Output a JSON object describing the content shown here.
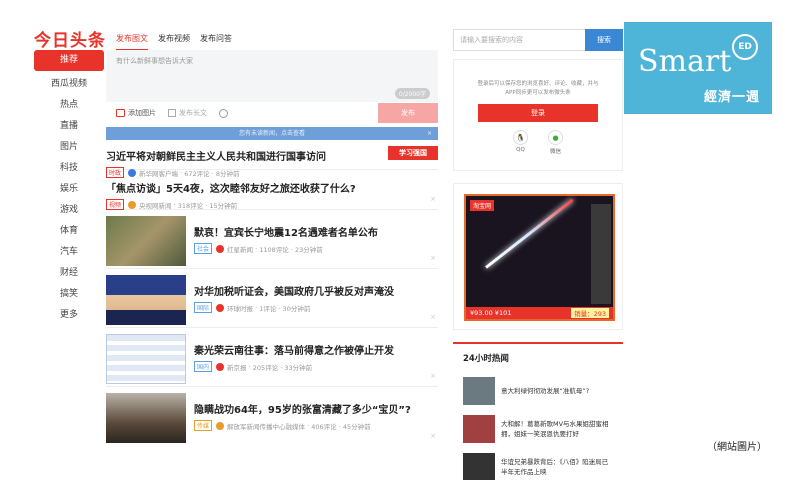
{
  "app": {
    "logo": "今日头条"
  },
  "nav": [
    "推荐",
    "西瓜视频",
    "热点",
    "直播",
    "图片",
    "科技",
    "娱乐",
    "游戏",
    "体育",
    "汽车",
    "财经",
    "搞笑",
    "更多"
  ],
  "composer": {
    "tabs": [
      "发布图文",
      "发布视频",
      "发布问答"
    ],
    "placeholder": "有什么新鲜事想告诉大家",
    "counter": "0/2000字",
    "add_image": "添加图片",
    "long_text": "发布长文",
    "publish": "发布"
  },
  "notice": "您有未读新闻，点击查看",
  "feed": [
    {
      "title": "习近平将对朝鲜民主主义人民共和国进行国事访问",
      "source": "新华网客户端",
      "meta": "672评论 · 8分钟前",
      "tag": "时政",
      "badge": "学习强国"
    },
    {
      "title": "「焦点访谈」5天4夜，这次睦邻友好之旅还收获了什么?",
      "source": "央视网新闻",
      "meta": "318评论 · 15分钟前",
      "tag": "视频"
    },
    {
      "title": "默哀！宜宾长宁地震12名遇难者名单公布",
      "source": "红星新闻",
      "meta": "1108评论 · 23分钟前",
      "tag": "社会"
    },
    {
      "title": "对华加税听证会，美国政府几乎被反对声淹没",
      "source": "环球时报",
      "meta": "1评论 · 30分钟前",
      "tag": "国际"
    },
    {
      "title": "秦光荣云南往事：落马前得意之作被停止开发",
      "source": "新京报",
      "meta": "205评论 · 33分钟前",
      "tag": "国内"
    },
    {
      "title": "隐瞒战功64年，95岁的张富清藏了多少“宝贝”?",
      "source": "解放军新闻传播中心融媒体",
      "meta": "406评论 · 45分钟前",
      "tag": "传媒"
    }
  ],
  "search": {
    "placeholder": "请输入要搜索的内容",
    "button": "搜索"
  },
  "brand": {
    "name": "Smart",
    "badge": "ED",
    "sub": "經濟一週"
  },
  "login": {
    "text": "登录后可以保存您的浏览喜好、评论、收藏，并与APP同步更可以发布微头条",
    "button": "登录",
    "qq": "QQ",
    "wechat": "微信"
  },
  "ad": {
    "logo": "淘宝网",
    "price": "¥93.00 ¥101",
    "sales": "销量：293"
  },
  "hot": {
    "title": "24小时热闻",
    "items": [
      "意大利绿何彻劝发展“准航母”?",
      "大和解！葛葛新歌MV与水果姐甜蜜相拥，姐妹一笑泯恩仇要打好",
      "华谊兄弟暴跌背后：《八佰》陷迷局已半年无作品上映"
    ]
  },
  "credit": "（網站圖片）",
  "colors": {
    "accent": "#e8332a",
    "link": "#3a87d6",
    "brand": "#4eb4d8"
  }
}
